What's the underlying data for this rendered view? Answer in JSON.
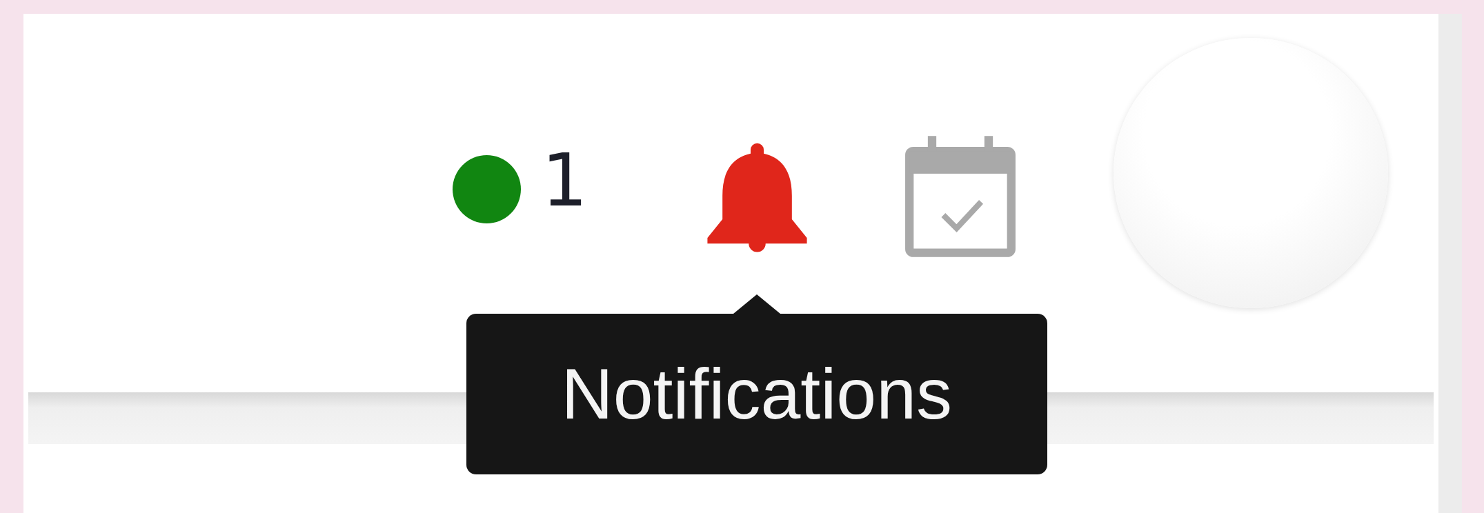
{
  "header": {
    "count": "1",
    "tooltip": "Notifications"
  }
}
